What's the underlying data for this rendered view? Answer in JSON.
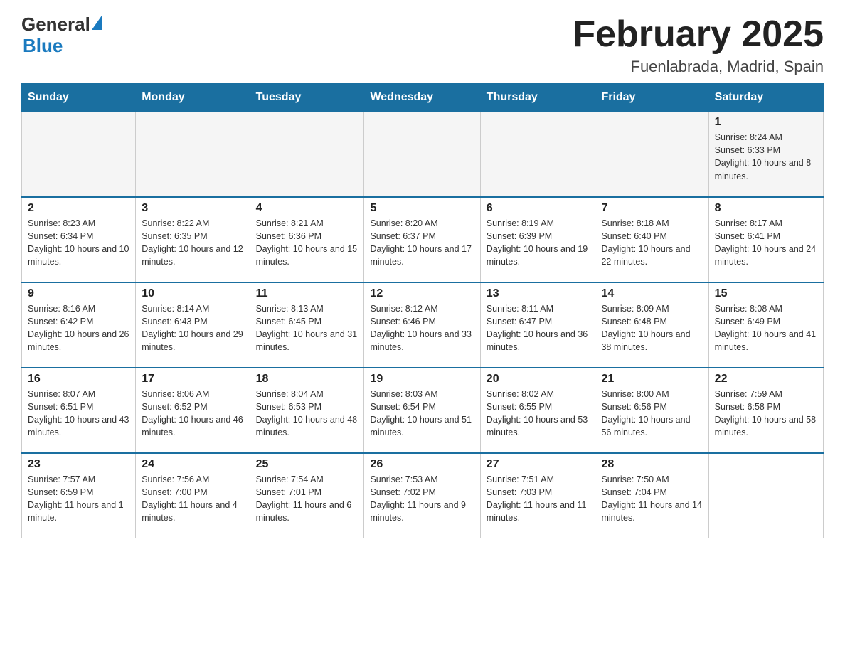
{
  "header": {
    "logo": {
      "general": "General",
      "blue": "Blue"
    },
    "title": "February 2025",
    "location": "Fuenlabrada, Madrid, Spain"
  },
  "weekdays": [
    "Sunday",
    "Monday",
    "Tuesday",
    "Wednesday",
    "Thursday",
    "Friday",
    "Saturday"
  ],
  "weeks": [
    [
      {
        "day": "",
        "info": ""
      },
      {
        "day": "",
        "info": ""
      },
      {
        "day": "",
        "info": ""
      },
      {
        "day": "",
        "info": ""
      },
      {
        "day": "",
        "info": ""
      },
      {
        "day": "",
        "info": ""
      },
      {
        "day": "1",
        "info": "Sunrise: 8:24 AM\nSunset: 6:33 PM\nDaylight: 10 hours and 8 minutes."
      }
    ],
    [
      {
        "day": "2",
        "info": "Sunrise: 8:23 AM\nSunset: 6:34 PM\nDaylight: 10 hours and 10 minutes."
      },
      {
        "day": "3",
        "info": "Sunrise: 8:22 AM\nSunset: 6:35 PM\nDaylight: 10 hours and 12 minutes."
      },
      {
        "day": "4",
        "info": "Sunrise: 8:21 AM\nSunset: 6:36 PM\nDaylight: 10 hours and 15 minutes."
      },
      {
        "day": "5",
        "info": "Sunrise: 8:20 AM\nSunset: 6:37 PM\nDaylight: 10 hours and 17 minutes."
      },
      {
        "day": "6",
        "info": "Sunrise: 8:19 AM\nSunset: 6:39 PM\nDaylight: 10 hours and 19 minutes."
      },
      {
        "day": "7",
        "info": "Sunrise: 8:18 AM\nSunset: 6:40 PM\nDaylight: 10 hours and 22 minutes."
      },
      {
        "day": "8",
        "info": "Sunrise: 8:17 AM\nSunset: 6:41 PM\nDaylight: 10 hours and 24 minutes."
      }
    ],
    [
      {
        "day": "9",
        "info": "Sunrise: 8:16 AM\nSunset: 6:42 PM\nDaylight: 10 hours and 26 minutes."
      },
      {
        "day": "10",
        "info": "Sunrise: 8:14 AM\nSunset: 6:43 PM\nDaylight: 10 hours and 29 minutes."
      },
      {
        "day": "11",
        "info": "Sunrise: 8:13 AM\nSunset: 6:45 PM\nDaylight: 10 hours and 31 minutes."
      },
      {
        "day": "12",
        "info": "Sunrise: 8:12 AM\nSunset: 6:46 PM\nDaylight: 10 hours and 33 minutes."
      },
      {
        "day": "13",
        "info": "Sunrise: 8:11 AM\nSunset: 6:47 PM\nDaylight: 10 hours and 36 minutes."
      },
      {
        "day": "14",
        "info": "Sunrise: 8:09 AM\nSunset: 6:48 PM\nDaylight: 10 hours and 38 minutes."
      },
      {
        "day": "15",
        "info": "Sunrise: 8:08 AM\nSunset: 6:49 PM\nDaylight: 10 hours and 41 minutes."
      }
    ],
    [
      {
        "day": "16",
        "info": "Sunrise: 8:07 AM\nSunset: 6:51 PM\nDaylight: 10 hours and 43 minutes."
      },
      {
        "day": "17",
        "info": "Sunrise: 8:06 AM\nSunset: 6:52 PM\nDaylight: 10 hours and 46 minutes."
      },
      {
        "day": "18",
        "info": "Sunrise: 8:04 AM\nSunset: 6:53 PM\nDaylight: 10 hours and 48 minutes."
      },
      {
        "day": "19",
        "info": "Sunrise: 8:03 AM\nSunset: 6:54 PM\nDaylight: 10 hours and 51 minutes."
      },
      {
        "day": "20",
        "info": "Sunrise: 8:02 AM\nSunset: 6:55 PM\nDaylight: 10 hours and 53 minutes."
      },
      {
        "day": "21",
        "info": "Sunrise: 8:00 AM\nSunset: 6:56 PM\nDaylight: 10 hours and 56 minutes."
      },
      {
        "day": "22",
        "info": "Sunrise: 7:59 AM\nSunset: 6:58 PM\nDaylight: 10 hours and 58 minutes."
      }
    ],
    [
      {
        "day": "23",
        "info": "Sunrise: 7:57 AM\nSunset: 6:59 PM\nDaylight: 11 hours and 1 minute."
      },
      {
        "day": "24",
        "info": "Sunrise: 7:56 AM\nSunset: 7:00 PM\nDaylight: 11 hours and 4 minutes."
      },
      {
        "day": "25",
        "info": "Sunrise: 7:54 AM\nSunset: 7:01 PM\nDaylight: 11 hours and 6 minutes."
      },
      {
        "day": "26",
        "info": "Sunrise: 7:53 AM\nSunset: 7:02 PM\nDaylight: 11 hours and 9 minutes."
      },
      {
        "day": "27",
        "info": "Sunrise: 7:51 AM\nSunset: 7:03 PM\nDaylight: 11 hours and 11 minutes."
      },
      {
        "day": "28",
        "info": "Sunrise: 7:50 AM\nSunset: 7:04 PM\nDaylight: 11 hours and 14 minutes."
      },
      {
        "day": "",
        "info": ""
      }
    ]
  ]
}
